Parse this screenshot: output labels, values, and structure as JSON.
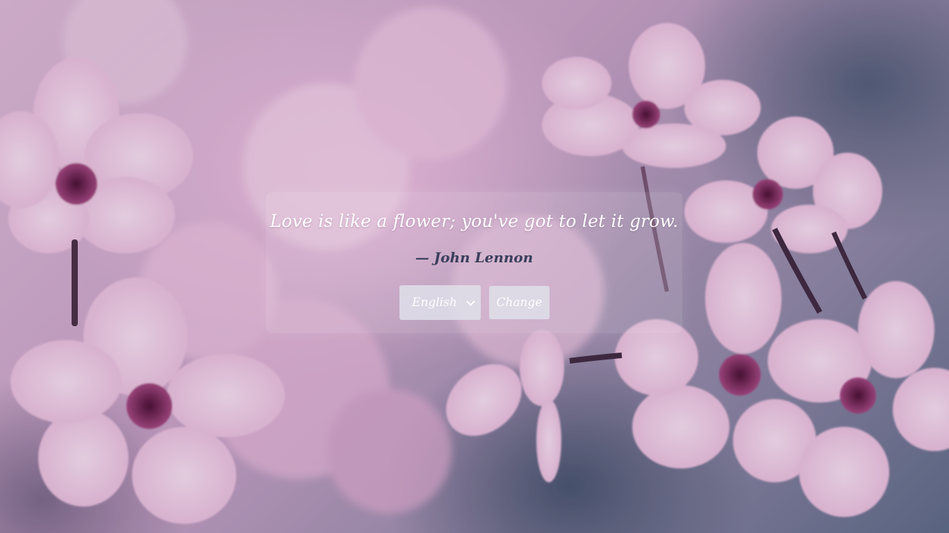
{
  "quote": {
    "text": "Love is like a flower; you've got to let it grow.",
    "author": "— John Lennon"
  },
  "controls": {
    "language_selected": "English",
    "change_label": "Change"
  },
  "colors": {
    "quote_text": "#ffffff",
    "author_text": "#3a3f5c",
    "control_bg": "#dedee8"
  }
}
